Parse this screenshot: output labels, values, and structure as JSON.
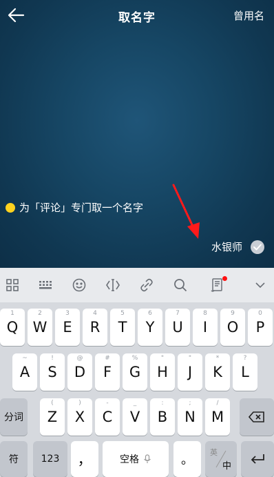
{
  "header": {
    "title": "取名字",
    "former_names_label": "曾用名"
  },
  "hint": {
    "text": "为「评论」专门取一个名字"
  },
  "name_suggestion": {
    "text": "水银师"
  },
  "toolbar": {
    "icons": [
      "grid-icon",
      "keyboard-icon",
      "emoji-icon",
      "cursor-icon",
      "link-icon",
      "search-icon",
      "scroll-icon",
      "chevron-down-icon"
    ]
  },
  "keyboard": {
    "row1": [
      {
        "main": "Q",
        "sub": "1"
      },
      {
        "main": "W",
        "sub": "2"
      },
      {
        "main": "E",
        "sub": "3"
      },
      {
        "main": "R",
        "sub": "4"
      },
      {
        "main": "T",
        "sub": "5"
      },
      {
        "main": "Y",
        "sub": "6"
      },
      {
        "main": "U",
        "sub": "7"
      },
      {
        "main": "I",
        "sub": "8"
      },
      {
        "main": "O",
        "sub": "9"
      },
      {
        "main": "P",
        "sub": "0"
      }
    ],
    "row2": [
      {
        "main": "A",
        "sub": "~"
      },
      {
        "main": "S",
        "sub": "!"
      },
      {
        "main": "D",
        "sub": "@"
      },
      {
        "main": "F",
        "sub": "#"
      },
      {
        "main": "G",
        "sub": "%"
      },
      {
        "main": "H",
        "sub": "\""
      },
      {
        "main": "J",
        "sub": "\""
      },
      {
        "main": "K",
        "sub": "*"
      },
      {
        "main": "L",
        "sub": "?"
      }
    ],
    "row3": [
      {
        "main": "Z",
        "sub": "("
      },
      {
        "main": "X",
        "sub": ")"
      },
      {
        "main": "C",
        "sub": "-"
      },
      {
        "main": "V",
        "sub": "_"
      },
      {
        "main": "B",
        "sub": ":"
      },
      {
        "main": "N",
        "sub": ";"
      },
      {
        "main": "M",
        "sub": "/"
      }
    ],
    "segment_label": "分词",
    "symbol_label": "符",
    "num_label": "123",
    "comma_label": "，",
    "space_label": "空格",
    "period_label": "。",
    "lang_top": "英",
    "lang_bottom": "中"
  },
  "colors": {
    "header_bg": "#12405e",
    "hint_dot": "#ffd21f",
    "annotation_arrow": "#ff1a1a"
  }
}
